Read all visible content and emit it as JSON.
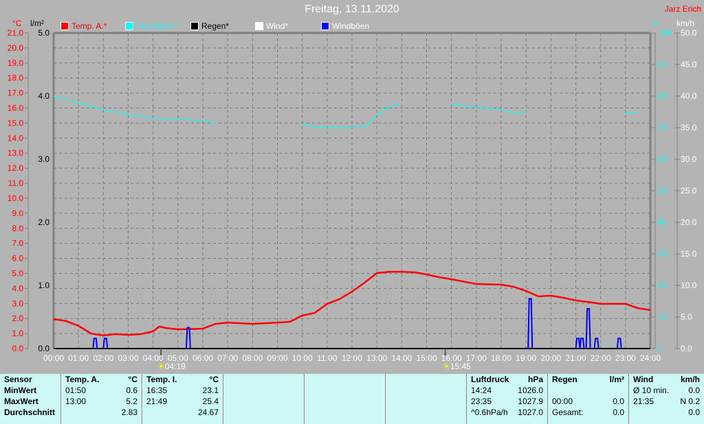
{
  "title": "Freitag, 13.11.2020",
  "owner": "Jarz Erich",
  "colors": {
    "temp": "#ff0000",
    "humidity": "#00ffff",
    "rain": "#000000",
    "wind": "#ffffff",
    "gusts": "#0000ff",
    "background": "#b4b4b4",
    "table": "#ccf8f5"
  },
  "legend": [
    {
      "label": "Temp. A.*",
      "color": "#ff0000"
    },
    {
      "label": "Feuchte A.*",
      "color": "#00ffff"
    },
    {
      "label": "Regen*",
      "color": "#000000"
    },
    {
      "label": "Wind*",
      "color": "#ffffff"
    },
    {
      "label": "Windböen",
      "color": "#0000ff"
    }
  ],
  "units": {
    "temp": "°C",
    "rain": "l/m²",
    "humidity": "%",
    "wind": "km/h"
  },
  "sun": {
    "sunrise": "04:19",
    "sunset": "15:45",
    "sunrise_icon": "sunrise-icon",
    "sunset_icon": "sunset-icon"
  },
  "chart_data": {
    "type": "line",
    "title": "Freitag, 13.11.2020",
    "x_ticks": [
      "00:00",
      "01:00",
      "02:00",
      "03:00",
      "04:00",
      "05:00",
      "06:00",
      "07:00",
      "08:00",
      "09:00",
      "10:00",
      "11:00",
      "12:00",
      "13:00",
      "14:00",
      "15:00",
      "16:00",
      "17:00",
      "18:00",
      "19:00",
      "20:00",
      "21:00",
      "22:00",
      "23:00",
      "24:00"
    ],
    "xlim_hours": [
      0,
      24
    ],
    "axes": {
      "temp": {
        "label": "°C",
        "range": [
          0,
          21
        ],
        "ticks": [
          "0.0",
          "1.0",
          "2.0",
          "3.0",
          "4.0",
          "5.0",
          "6.0",
          "7.0",
          "8.0",
          "9.0",
          "10.0",
          "11.0",
          "12.0",
          "13.0",
          "14.0",
          "15.0",
          "16.0",
          "17.0",
          "18.0",
          "19.0",
          "20.0",
          "21.0"
        ]
      },
      "rain": {
        "label": "l/m²",
        "range": [
          0,
          5
        ],
        "ticks": [
          "0.0",
          "1.0",
          "2.0",
          "3.0",
          "4.0",
          "5.0"
        ]
      },
      "humidity": {
        "label": "%",
        "range": [
          0,
          100
        ],
        "ticks": [
          "0",
          "10",
          "20",
          "30",
          "40",
          "50",
          "60",
          "70",
          "80",
          "90",
          "100"
        ]
      },
      "wind": {
        "label": "km/h",
        "range": [
          0,
          50
        ],
        "ticks": [
          "0.0",
          "5.0",
          "10.0",
          "15.0",
          "20.0",
          "25.0",
          "30.0",
          "35.0",
          "40.0",
          "45.0",
          "50.0"
        ]
      }
    },
    "grid": true,
    "legend_placement": "top",
    "series": [
      {
        "name": "Temp. A.*",
        "axis": "temp",
        "color": "#ff0000",
        "x": [
          "00:00",
          "00:30",
          "01:00",
          "01:30",
          "02:00",
          "02:30",
          "03:00",
          "03:30",
          "04:00",
          "04:15",
          "04:30",
          "05:00",
          "06:00",
          "06:30",
          "07:00",
          "08:00",
          "09:00",
          "09:30",
          "10:00",
          "10:30",
          "11:00",
          "11:30",
          "12:00",
          "12:30",
          "13:00",
          "13:30",
          "14:00",
          "14:30",
          "15:00",
          "15:30",
          "16:00",
          "17:00",
          "18:00",
          "18:30",
          "19:00",
          "19:30",
          "20:00",
          "20:30",
          "21:00",
          "21:30",
          "22:00",
          "23:00",
          "23:30",
          "24:00"
        ],
        "y": [
          1.96,
          1.83,
          1.51,
          1.0,
          0.87,
          0.96,
          0.91,
          0.96,
          1.14,
          1.46,
          1.37,
          1.28,
          1.32,
          1.64,
          1.73,
          1.64,
          1.73,
          1.78,
          2.19,
          2.37,
          2.97,
          3.29,
          3.79,
          4.38,
          5.02,
          5.11,
          5.11,
          5.07,
          4.93,
          4.75,
          4.61,
          4.29,
          4.25,
          4.11,
          3.83,
          3.47,
          3.52,
          3.38,
          3.2,
          3.1,
          2.97,
          2.97,
          2.69,
          2.56
        ]
      },
      {
        "name": "Feuchte A.*",
        "axis": "humidity",
        "color": "#00ffff",
        "x": [
          "00:00",
          "01:00",
          "02:00",
          "03:00",
          "04:00",
          "05:00",
          "06:00",
          "06:30",
          "07:00",
          "10:00",
          "11:00",
          "12:00",
          "12:30",
          "13:00",
          "13:30",
          "14:00",
          "14:30",
          "16:00",
          "17:00",
          "18:00",
          "18:30",
          "19:00",
          "19:30",
          "23:00",
          "23:30"
        ],
        "y": [
          80,
          77.8,
          75.7,
          74.3,
          73,
          72.8,
          72,
          71.3,
          null,
          70.7,
          70,
          70,
          70.2,
          74,
          76.5,
          77.8,
          null,
          77.4,
          76.5,
          75.7,
          74.6,
          75,
          null,
          74.6,
          74.6
        ]
      },
      {
        "name": "Windböen",
        "axis": "wind",
        "color": "#0000ff",
        "x": [
          "01:40",
          "02:05",
          "05:25",
          "19:10",
          "21:05",
          "21:15",
          "21:30",
          "21:50",
          "22:45"
        ],
        "y": [
          1.6,
          1.6,
          3.3,
          7.9,
          1.6,
          1.6,
          6.3,
          1.6,
          1.6
        ]
      }
    ]
  },
  "stats": {
    "sensor": {
      "header": "Sensor",
      "rows": [
        "MinWert",
        "MaxWert",
        "Durchschnitt"
      ]
    },
    "temp_a": {
      "header": "Temp. A.",
      "unit": "°C",
      "rows": [
        [
          "01:50",
          "0.6"
        ],
        [
          "13:00",
          "5.2"
        ],
        [
          "",
          "2.83"
        ]
      ]
    },
    "temp_i": {
      "header": "Temp. I.",
      "unit": "°C",
      "rows": [
        [
          "16:35",
          "23.1"
        ],
        [
          "21:49",
          "25.4"
        ],
        [
          "",
          "24.67"
        ]
      ]
    },
    "pressure": {
      "header": "Luftdruck",
      "unit": "hPa",
      "rows": [
        [
          "14:24",
          "1026.0"
        ],
        [
          "23:35",
          "1027.9"
        ],
        [
          "^0.6hPa/h",
          "1027.0"
        ]
      ]
    },
    "rain": {
      "header": "Regen",
      "unit": "l/m²",
      "rows": [
        [
          "",
          ""
        ],
        [
          "00:00",
          "0.0"
        ],
        [
          "Gesamt:",
          "0.0"
        ]
      ]
    },
    "wind": {
      "header": "Wind",
      "unit": "km/h",
      "rows": [
        [
          "Ø 10 min.",
          "0.0"
        ],
        [
          "21:35",
          "N 0.2"
        ],
        [
          "",
          "0.0"
        ]
      ]
    }
  }
}
